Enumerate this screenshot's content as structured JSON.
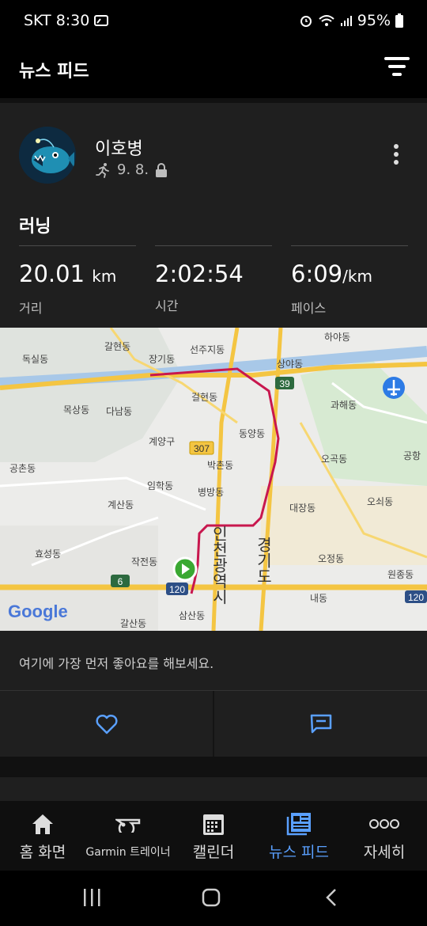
{
  "status_bar": {
    "carrier_time": "SKT 8:30",
    "battery": "95%"
  },
  "header": {
    "title": "뉴스 피드"
  },
  "post": {
    "user_name": "이호병",
    "date": "9. 8.",
    "activity_type": "러닝",
    "stats": [
      {
        "value": "20.01",
        "unit": "km",
        "label": "거리"
      },
      {
        "value": "2:02:54",
        "unit": "",
        "label": "시간"
      },
      {
        "value": "6:09",
        "unit": "/km",
        "label": "페이스"
      }
    ],
    "map": {
      "places": [
        "갈현동",
        "하야동",
        "독실동",
        "장기동",
        "선주지동",
        "상야동",
        "걸현동",
        "과해동",
        "목상동",
        "다남동",
        "동양동",
        "계양구",
        "공촌동",
        "박촌동",
        "오곡동",
        "공항",
        "임학동",
        "병방동",
        "대장동",
        "오쇠동",
        "계산동",
        "효성동",
        "작전동",
        "오정동",
        "원종동",
        "내동",
        "삼산동",
        "갈산동",
        "인천광역시",
        "경기도"
      ],
      "road_numbers": [
        "39",
        "307",
        "6",
        "120",
        "120"
      ],
      "logo": "Google"
    },
    "like_prompt": "여기에 가장 먼저 좋아요를 해보세요."
  },
  "bottom_nav": {
    "items": [
      {
        "label": "홈 화면",
        "icon": "home-icon"
      },
      {
        "label": "Garmin 트레이너",
        "icon": "whistle-icon"
      },
      {
        "label": "캘린더",
        "icon": "calendar-icon"
      },
      {
        "label": "뉴스 피드",
        "icon": "news-feed-icon"
      },
      {
        "label": "자세히",
        "icon": "more-circles-icon"
      }
    ],
    "active_index": 3
  },
  "colors": {
    "accent": "#5aa0ff",
    "card": "#1f1f1f",
    "route": "#c8174e",
    "start_marker": "#3aa832"
  }
}
